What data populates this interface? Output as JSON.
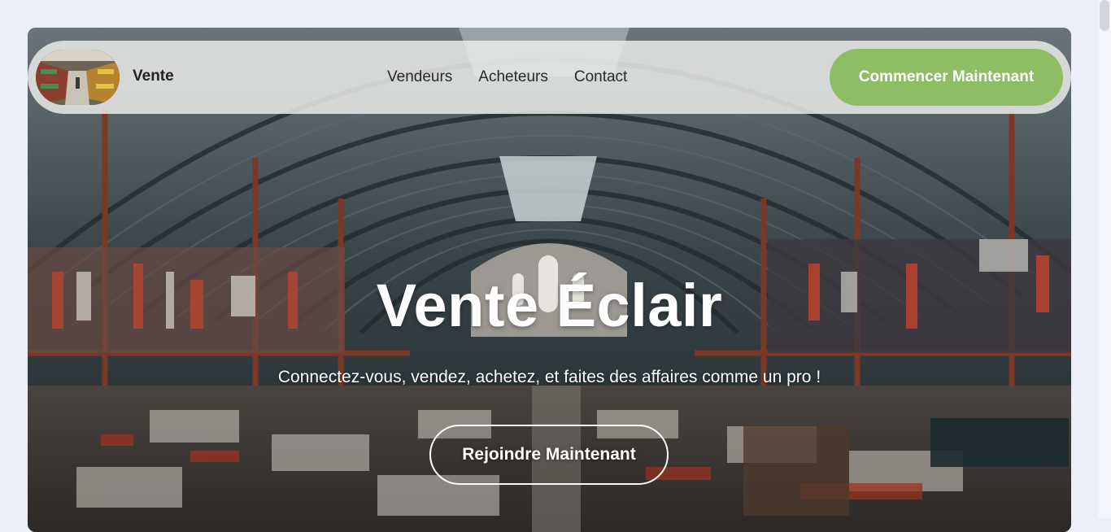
{
  "brand": {
    "name": "Vente",
    "logo_icon": "supermarket-aisle-photo"
  },
  "nav": {
    "links": [
      "Vendeurs",
      "Acheteurs",
      "Contact"
    ],
    "cta_label": "Commencer Maintenant"
  },
  "hero": {
    "background_icon": "market-hall-photo",
    "title": "Vente Éclair",
    "subtitle": "Connectez-vous, vendez, achetez, et faites des affaires comme un pro !",
    "join_label": "Rejoindre Maintenant"
  },
  "colors": {
    "page_bg": "#eceff8",
    "accent": "#8fbd64",
    "navbar_bg": "#e8eae8"
  }
}
